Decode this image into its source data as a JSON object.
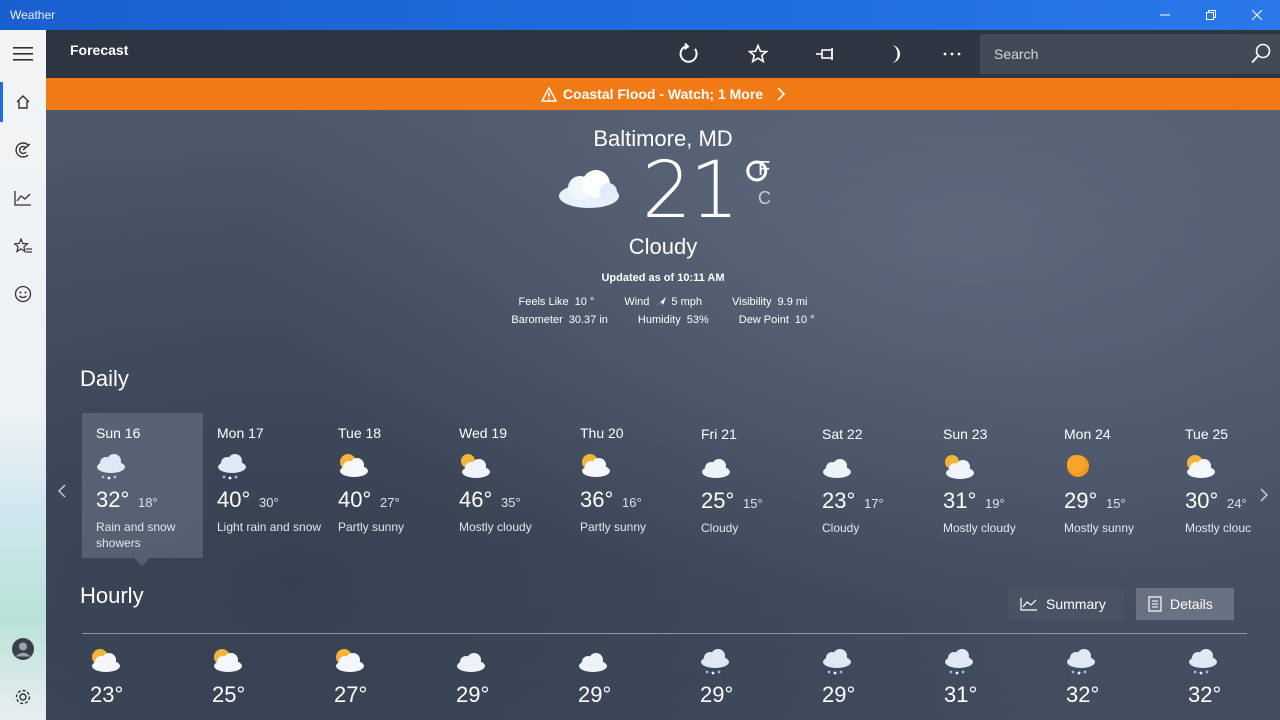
{
  "window": {
    "title": "Weather"
  },
  "appbar": {
    "page_title": "Forecast",
    "search_placeholder": "Search"
  },
  "alert": {
    "text": "Coastal Flood - Watch; 1 More"
  },
  "current": {
    "city": "Baltimore, MD",
    "temp": "21",
    "unit_f": "F",
    "unit_c": "C",
    "condition": "Cloudy",
    "updated": "Updated as of 10:11 AM",
    "details": {
      "feels_like_label": "Feels Like",
      "feels_like": "10 °",
      "wind_label": "Wind",
      "wind": "5 mph",
      "visibility_label": "Visibility",
      "visibility": "9.9 mi",
      "barometer_label": "Barometer",
      "barometer": "30.37 in",
      "humidity_label": "Humidity",
      "humidity": "53%",
      "dew_point_label": "Dew Point",
      "dew_point": "10 °"
    }
  },
  "daily": {
    "title": "Daily",
    "days": [
      {
        "name": "Sun 16",
        "hi": "32°",
        "lo": "18°",
        "desc": "Rain and snow showers",
        "icon": "rain-snow-icon"
      },
      {
        "name": "Mon 17",
        "hi": "40°",
        "lo": "30°",
        "desc": "Light rain and snow",
        "icon": "rain-snow-icon"
      },
      {
        "name": "Tue 18",
        "hi": "40°",
        "lo": "27°",
        "desc": "Partly sunny",
        "icon": "partly-sunny-icon"
      },
      {
        "name": "Wed 19",
        "hi": "46°",
        "lo": "35°",
        "desc": "Mostly cloudy",
        "icon": "mostly-cloudy-icon"
      },
      {
        "name": "Thu 20",
        "hi": "36°",
        "lo": "16°",
        "desc": "Partly sunny",
        "icon": "partly-sunny-icon"
      },
      {
        "name": "Fri 21",
        "hi": "25°",
        "lo": "15°",
        "desc": "Cloudy",
        "icon": "cloud-icon"
      },
      {
        "name": "Sat 22",
        "hi": "23°",
        "lo": "17°",
        "desc": "Cloudy",
        "icon": "cloud-icon"
      },
      {
        "name": "Sun 23",
        "hi": "31°",
        "lo": "19°",
        "desc": "Mostly cloudy",
        "icon": "mostly-cloudy-icon"
      },
      {
        "name": "Mon 24",
        "hi": "29°",
        "lo": "15°",
        "desc": "Mostly sunny",
        "icon": "sun-icon"
      },
      {
        "name": "Tue 25",
        "hi": "30°",
        "lo": "24°",
        "desc": "Mostly clouc",
        "icon": "partly-sunny-icon"
      }
    ]
  },
  "hourly": {
    "title": "Hourly",
    "summary_label": "Summary",
    "details_label": "Details",
    "hours": [
      {
        "temp": "23°",
        "icon": "partly-sunny-icon"
      },
      {
        "temp": "25°",
        "icon": "partly-sunny-icon"
      },
      {
        "temp": "27°",
        "icon": "partly-sunny-icon"
      },
      {
        "temp": "29°",
        "icon": "cloud-icon"
      },
      {
        "temp": "29°",
        "icon": "cloud-icon"
      },
      {
        "temp": "29°",
        "icon": "rain-snow-icon"
      },
      {
        "temp": "29°",
        "icon": "rain-snow-icon"
      },
      {
        "temp": "31°",
        "icon": "rain-snow-icon"
      },
      {
        "temp": "32°",
        "icon": "rain-snow-icon"
      },
      {
        "temp": "32°",
        "icon": "rain-snow-icon"
      }
    ]
  },
  "colors": {
    "accent": "#1f6ee0",
    "alert": "#f07a16"
  }
}
